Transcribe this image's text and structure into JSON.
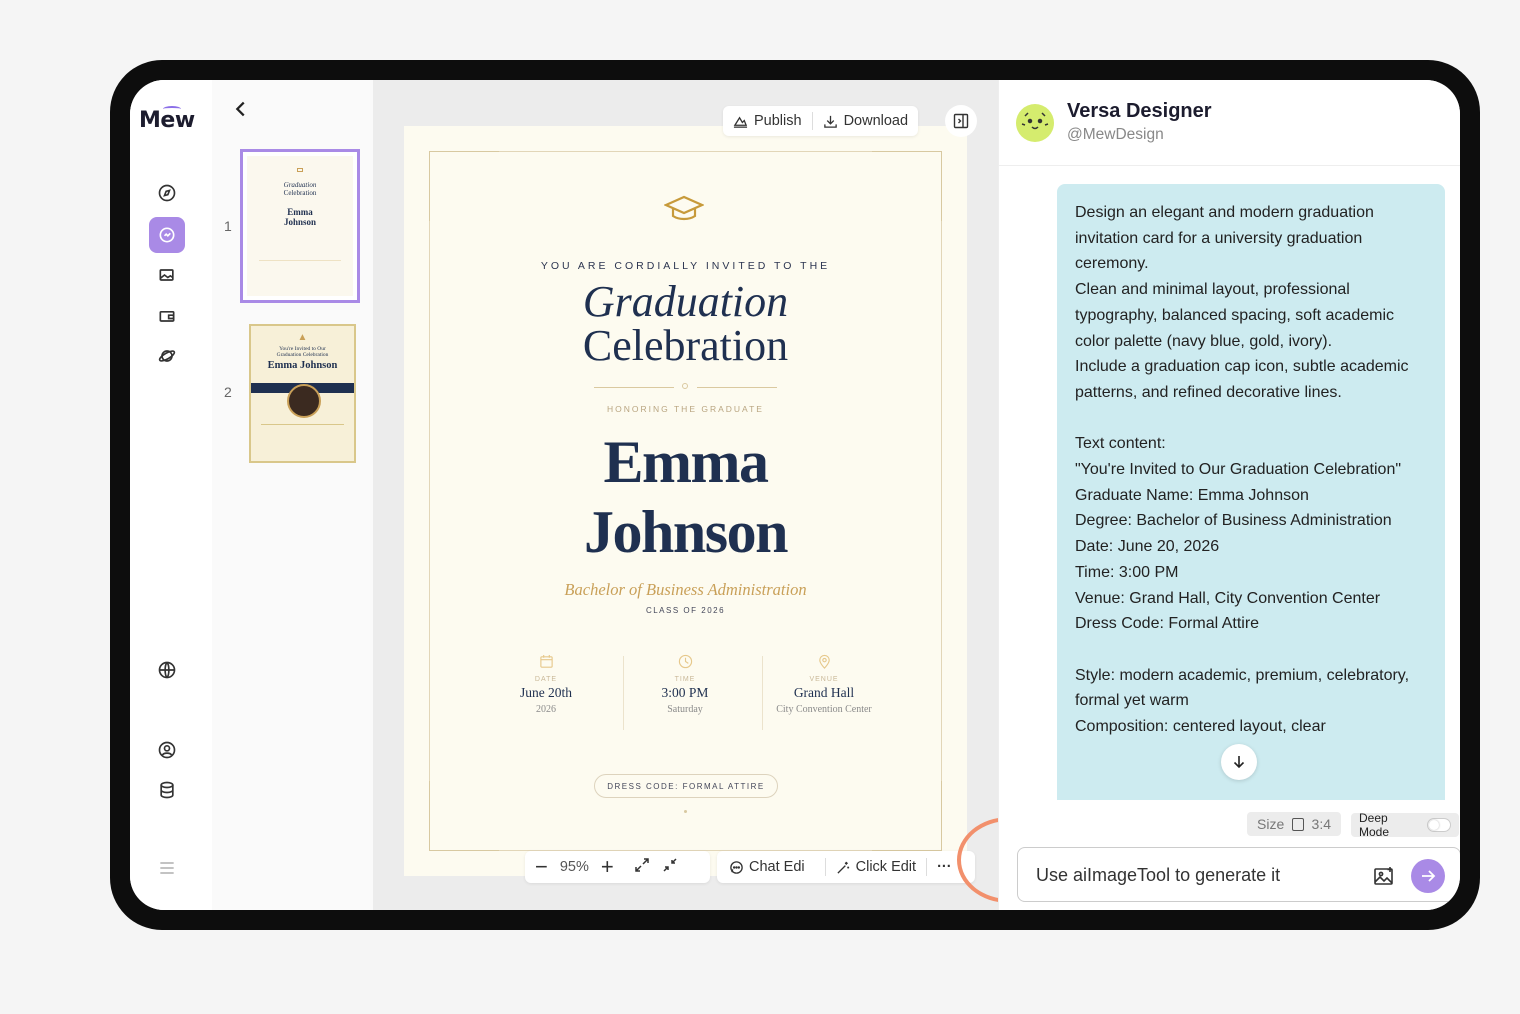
{
  "app": {
    "logo": "Mew"
  },
  "pages": {
    "numbers": [
      "1",
      "2"
    ]
  },
  "thumb1": {
    "line1": "Graduation",
    "line2": "Celebration",
    "line3": "Emma",
    "line4": "Johnson"
  },
  "thumb2": {
    "line1": "You're Invited to Our",
    "line2": "Graduation Celebration",
    "name": "Emma Johnson"
  },
  "toolbar": {
    "publish": "Publish",
    "download": "Download"
  },
  "card": {
    "pre": "YOU ARE CORDIALLY INVITED TO THE",
    "title1": "Graduation",
    "title2": "Celebration",
    "honoring": "HONORING THE GRADUATE",
    "first_name": "Emma",
    "last_name": "Johnson",
    "degree": "Bachelor of Business Administration",
    "class": "CLASS OF 2026",
    "date_label": "DATE",
    "date_value": "June 20th",
    "date_sub": "2026",
    "time_label": "TIME",
    "time_value": "3:00 PM",
    "time_sub": "Saturday",
    "venue_label": "VENUE",
    "venue_value": "Grand Hall",
    "venue_sub": "City Convention Center",
    "dress": "DRESS CODE: FORMAL ATTIRE"
  },
  "bottom_bar": {
    "zoom": "95%",
    "chat_edit": "Chat Edi",
    "click_edit": "Click Edit",
    "more": "···"
  },
  "chat": {
    "name": "Versa Designer",
    "handle": "@MewDesign",
    "message": "Design an elegant and modern graduation invitation card for a university graduation ceremony.\nClean and minimal layout, professional typography, balanced spacing, soft academic color palette (navy blue, gold, ivory).\nInclude a graduation cap icon, subtle academic patterns, and refined decorative lines.\n\nText content:\n\"You're Invited to Our Graduation Celebration\"\nGraduate Name: Emma Johnson\nDegree: Bachelor of Business Administration\nDate: June 20, 2026\nTime: 3:00 PM\nVenue: Grand Hall, City Convention Center\nDress Code: Formal Attire\n\nStyle: modern academic, premium, celebratory, formal yet warm\nComposition: centered layout, clear",
    "size_label": "Size",
    "size_value": "3:4",
    "deep_mode": "Deep Mode",
    "input_value": "Use aiImageTool to generate it"
  },
  "colors": {
    "accent": "#a98ae6",
    "navy": "#1f3050",
    "gold": "#c9a058",
    "bubble": "#cdebf0",
    "highlight": "#f2906c"
  }
}
